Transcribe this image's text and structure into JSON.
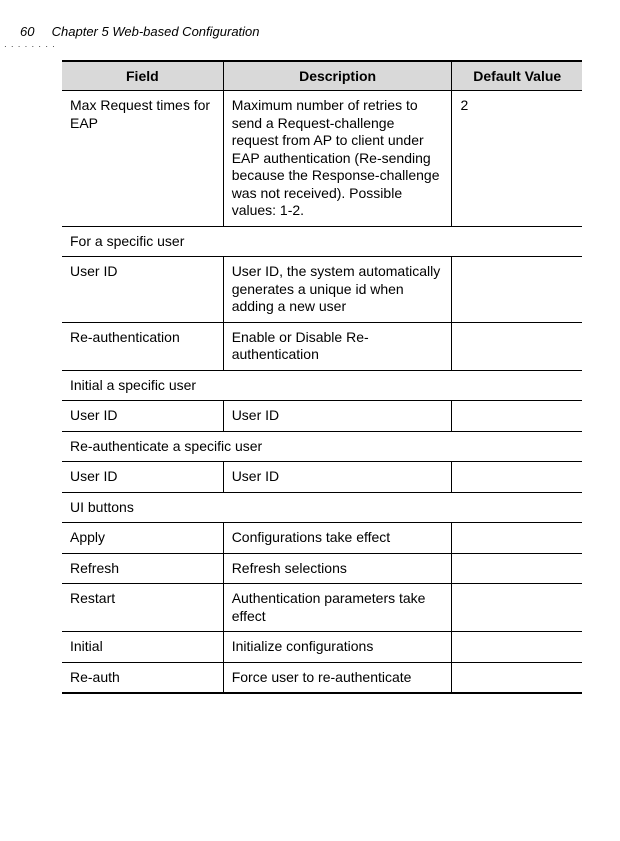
{
  "header": {
    "page_number": "60",
    "chapter": "Chapter 5 Web-based Configuration"
  },
  "table": {
    "headers": {
      "field": "Field",
      "description": "Description",
      "default": "Default Value"
    },
    "rows": [
      {
        "type": "row",
        "field": "Max Request times for EAP",
        "description": "Maximum number of retries to send a Request-challenge request from AP to client under EAP authentication (Re-sending because the Response-challenge was not received). Possible values: 1-2.",
        "default": "2"
      },
      {
        "type": "section",
        "label": "For a specific user"
      },
      {
        "type": "row",
        "field": "User ID",
        "description": "User ID, the system automatically generates a unique id when adding a new user",
        "default": ""
      },
      {
        "type": "row",
        "field": "Re-authentication",
        "description": "Enable or Disable Re-authentication",
        "default": ""
      },
      {
        "type": "section",
        "label": "Initial a specific user"
      },
      {
        "type": "row",
        "field": "User ID",
        "description": "User ID",
        "default": ""
      },
      {
        "type": "section",
        "label": "Re-authenticate a specific user"
      },
      {
        "type": "row",
        "field": "User ID",
        "description": "User ID",
        "default": ""
      },
      {
        "type": "section",
        "label": "UI buttons"
      },
      {
        "type": "row",
        "field": "Apply",
        "description": "Configurations take effect",
        "default": ""
      },
      {
        "type": "row",
        "field": "Refresh",
        "description": "Refresh selections",
        "default": ""
      },
      {
        "type": "row",
        "field": "Restart",
        "description": "Authentication parameters take effect",
        "default": ""
      },
      {
        "type": "row",
        "field": "Initial",
        "description": "Initialize configurations",
        "default": ""
      },
      {
        "type": "row",
        "field": "Re-auth",
        "description": "Force user to re-authenticate",
        "default": ""
      }
    ]
  }
}
